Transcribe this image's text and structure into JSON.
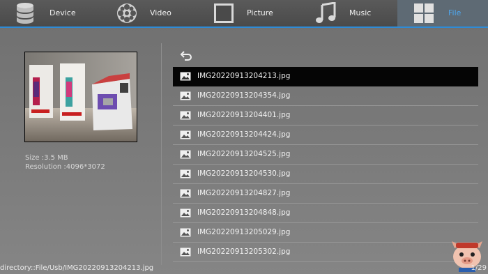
{
  "tabs": [
    {
      "label": "Device",
      "icon": "database-icon",
      "active": false
    },
    {
      "label": "Video",
      "icon": "film-reel-icon",
      "active": false
    },
    {
      "label": "Picture",
      "icon": "picture-frame-icon",
      "active": false
    },
    {
      "label": "Music",
      "icon": "music-note-icon",
      "active": false
    },
    {
      "label": "File",
      "icon": "grid-icon",
      "active": true
    }
  ],
  "preview": {
    "size": "Size :3.5 MB",
    "resolution": "Resolution :4096*3072"
  },
  "files": [
    "IMG20220913204213.jpg",
    "IMG20220913204354.jpg",
    "IMG20220913204401.jpg",
    "IMG20220913204424.jpg",
    "IMG20220913204525.jpg",
    "IMG20220913204530.jpg",
    "IMG20220913204827.jpg",
    "IMG20220913204848.jpg",
    "IMG20220913205029.jpg",
    "IMG20220913205302.jpg"
  ],
  "selected_index": 0,
  "status": {
    "directory": "directory::File/Usb/IMG20220913204213.jpg",
    "count": "1/29"
  },
  "colors": {
    "accent": "#2e8bd6",
    "active_label": "#4ea6ee",
    "selected_row": "#050505"
  }
}
